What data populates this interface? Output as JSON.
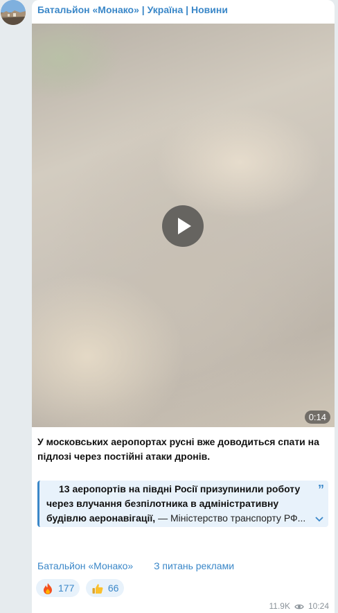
{
  "channel": {
    "title": "Батальйон «Монако» | Україна | Новини",
    "avatar_icon": "channel-avatar"
  },
  "video": {
    "duration": "0:14",
    "play_icon": "play-icon"
  },
  "post": {
    "text": "У московських аеропортах русні вже доводиться спати на підлозі через постійні атаки дронів.",
    "quote": {
      "text": "13 аеропортів на півдні Росії призупинили роботу через влучання безпілотника в адміністративну будівлю аеронавігації,",
      "source": "— Міністерство транспорту РФ...",
      "quote_icon": "quote-mark-icon",
      "expand_icon": "chevron-down-icon"
    }
  },
  "footer": {
    "links": [
      "Батальйон «Монако»",
      "З питань реклами"
    ]
  },
  "reactions": [
    {
      "emoji": "fire-icon",
      "count": "177"
    },
    {
      "emoji": "thumbs-up-icon",
      "count": "66"
    }
  ],
  "meta": {
    "views": "11.9K",
    "time": "10:24",
    "views_icon": "eye-icon"
  },
  "colors": {
    "accent": "#3a87c8",
    "background": "#e6ebee",
    "quote_background": "#e8f2fb"
  }
}
